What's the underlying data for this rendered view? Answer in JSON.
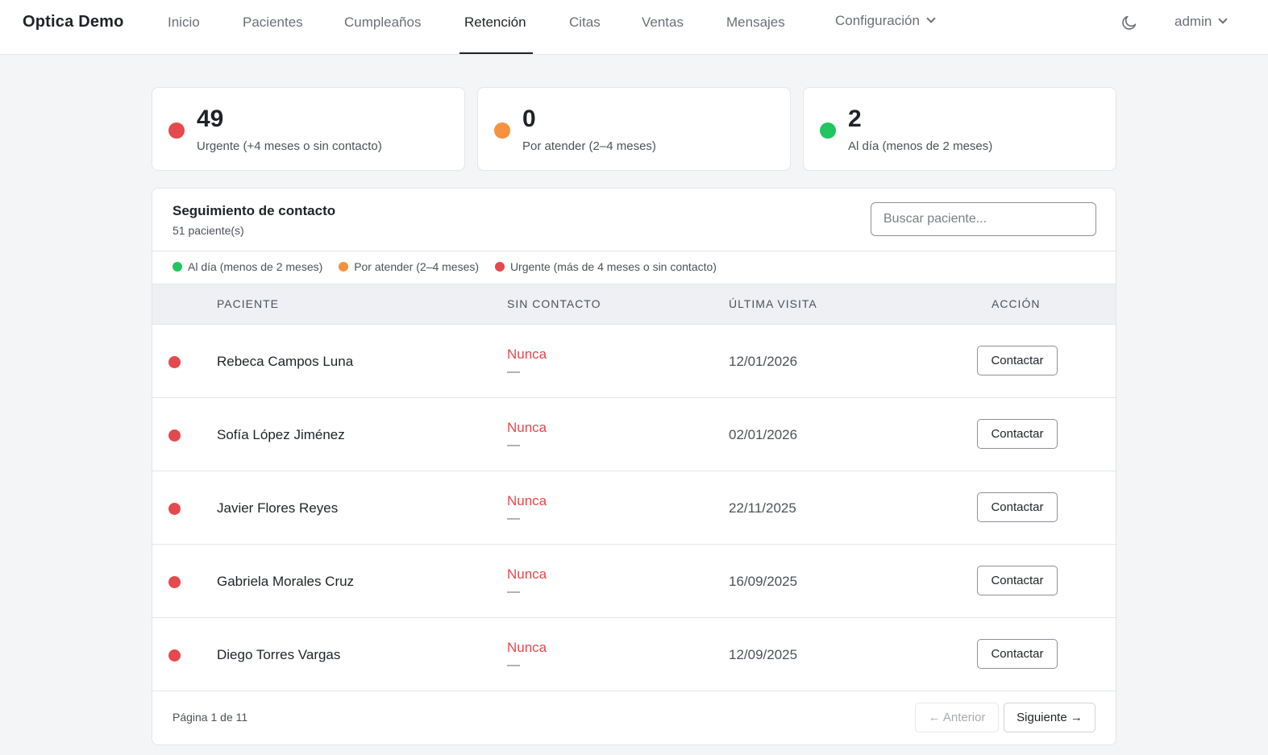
{
  "navbar": {
    "brand": "Optica Demo",
    "items": [
      {
        "label": "Inicio"
      },
      {
        "label": "Pacientes"
      },
      {
        "label": "Cumpleaños"
      },
      {
        "label": "Retención"
      },
      {
        "label": "Citas"
      },
      {
        "label": "Ventas"
      },
      {
        "label": "Mensajes"
      },
      {
        "label": "Configuración"
      }
    ],
    "active": "Retención",
    "user": "admin",
    "theme_icon": "moon-icon"
  },
  "stats": [
    {
      "value": "49",
      "label": "Urgente (+4 meses o sin contacto)",
      "color": "#e5484d"
    },
    {
      "value": "0",
      "label": "Por atender (2–4 meses)",
      "color": "#f5923e"
    },
    {
      "value": "2",
      "label": "Al día (menos de 2 meses)",
      "color": "#22c55e"
    }
  ],
  "panel": {
    "title": "Seguimiento de contacto",
    "subtitle": "51 paciente(s)",
    "search_placeholder": "Buscar paciente...",
    "legend": [
      {
        "label": "Al día (menos de 2 meses)",
        "color": "#22c55e"
      },
      {
        "label": "Por atender (2–4 meses)",
        "color": "#f5923e"
      },
      {
        "label": "Urgente (más de 4 meses o sin contacto)",
        "color": "#e5484d"
      }
    ],
    "columns": {
      "patient": "PACIENTE",
      "no_contact": "SIN CONTACTO",
      "last_visit": "ÚLTIMA VISITA",
      "action": "ACCIÓN"
    },
    "rows": [
      {
        "name": "Rebeca Campos Luna",
        "status": "Nunca",
        "detail": "—",
        "last_visit": "12/01/2026",
        "action": "Contactar",
        "color": "#e5484d"
      },
      {
        "name": "Sofía López Jiménez",
        "status": "Nunca",
        "detail": "—",
        "last_visit": "02/01/2026",
        "action": "Contactar",
        "color": "#e5484d"
      },
      {
        "name": "Javier Flores Reyes",
        "status": "Nunca",
        "detail": "—",
        "last_visit": "22/11/2025",
        "action": "Contactar",
        "color": "#e5484d"
      },
      {
        "name": "Gabriela Morales Cruz",
        "status": "Nunca",
        "detail": "—",
        "last_visit": "16/09/2025",
        "action": "Contactar",
        "color": "#e5484d"
      },
      {
        "name": "Diego Torres Vargas",
        "status": "Nunca",
        "detail": "—",
        "last_visit": "12/09/2025",
        "action": "Contactar",
        "color": "#e5484d"
      }
    ],
    "pagination": {
      "info": "Página 1 de 11",
      "prev": "← Anterior",
      "next": "Siguiente →"
    }
  }
}
